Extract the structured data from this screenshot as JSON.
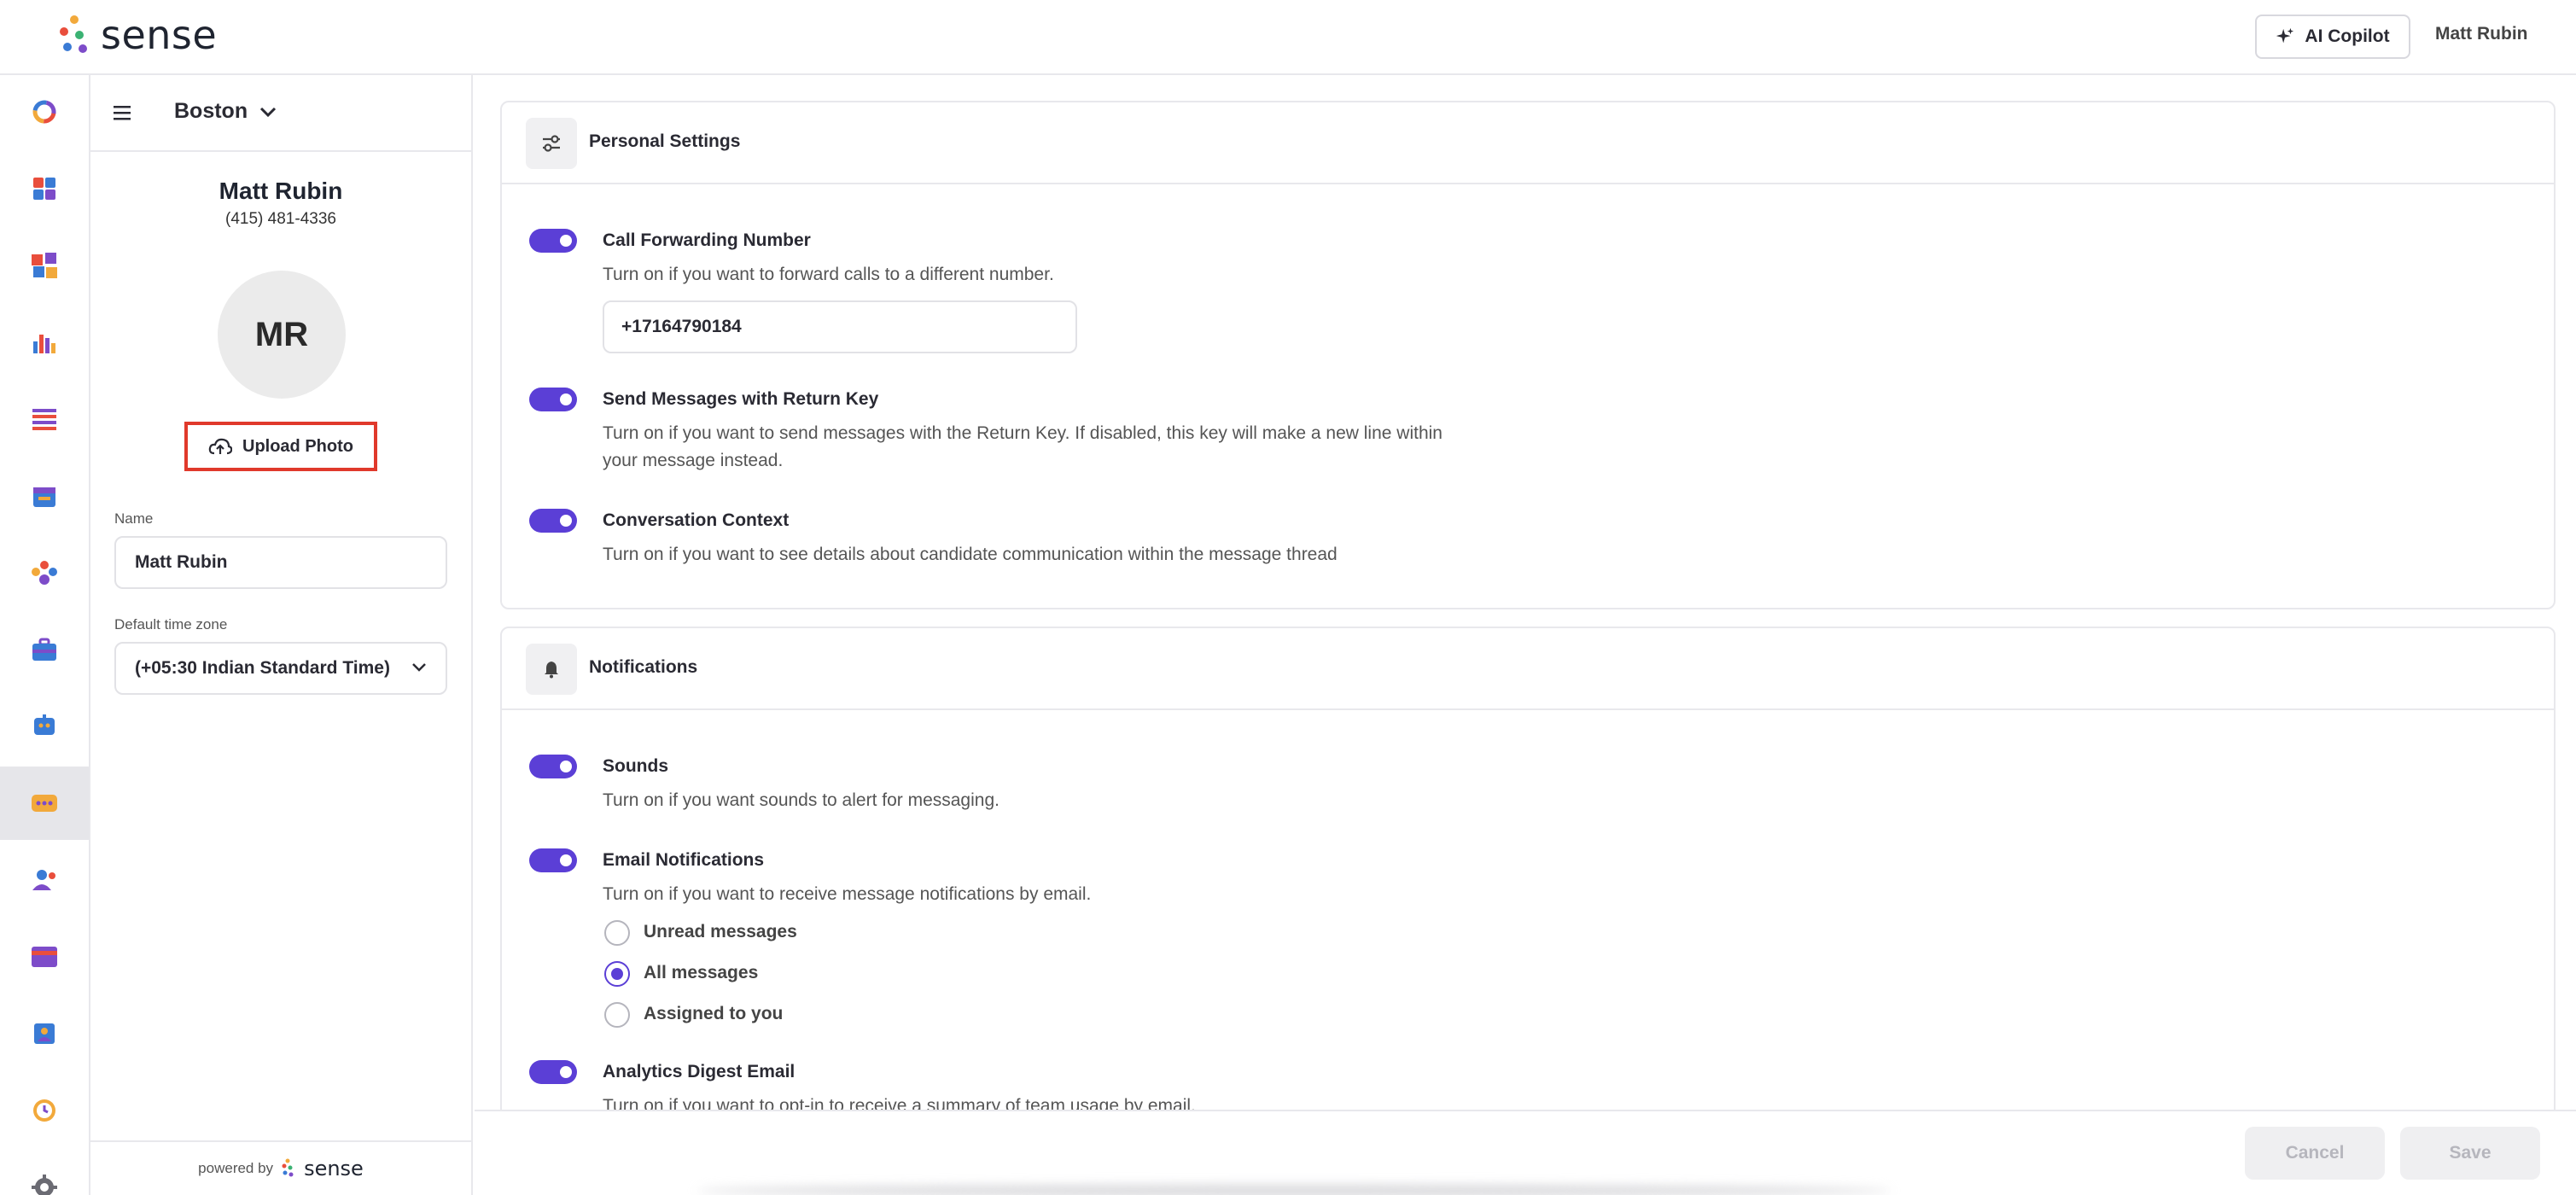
{
  "header": {
    "brand": "sense",
    "copilot_label": "AI Copilot",
    "user_name": "Matt Rubin"
  },
  "rail": {
    "icons": [
      "loading-ring-icon",
      "dashboard-icon",
      "puzzle-icon",
      "analytics-icon",
      "list-icon",
      "calendar-icon",
      "people-icon",
      "briefcase-icon",
      "chatbot-icon",
      "messages-icon",
      "contact-icon",
      "card-icon",
      "profile-card-icon",
      "clock-icon",
      "settings-icon"
    ],
    "active_index": 9
  },
  "profile": {
    "location": "Boston",
    "name": "Matt Rubin",
    "phone": "(415) 481-4336",
    "initials": "MR",
    "upload_label": "Upload Photo",
    "name_label": "Name",
    "name_value": "Matt Rubin",
    "tz_label": "Default time zone",
    "tz_value": "(+05:30 Indian Standard Time)",
    "powered_by": "powered by",
    "powered_brand": "sense"
  },
  "personal": {
    "title": "Personal Settings",
    "forwarding": {
      "title": "Call Forwarding Number",
      "desc": "Turn on if you want to forward calls to a different number.",
      "number": "+17164790184",
      "enabled": true
    },
    "return_key": {
      "title": "Send Messages with Return Key",
      "desc": "Turn on if you want to send messages with the Return Key. If disabled, this key will make a new line within your message instead.",
      "enabled": true
    },
    "context": {
      "title": "Conversation Context",
      "desc": "Turn on if you want to see details about candidate communication within the message thread",
      "enabled": true
    }
  },
  "notifications": {
    "title": "Notifications",
    "sounds": {
      "title": "Sounds",
      "desc": "Turn on if you want sounds to alert for messaging.",
      "enabled": true
    },
    "email": {
      "title": "Email Notifications",
      "desc": "Turn on if you want to receive message notifications by email.",
      "enabled": true,
      "options": [
        "Unread messages",
        "All messages",
        "Assigned to you"
      ],
      "selected": "All messages"
    },
    "digest": {
      "title": "Analytics Digest Email",
      "desc": "Turn on if you want to opt-in to receive a summary of team usage by email.",
      "enabled": true
    }
  },
  "footer": {
    "cancel_label": "Cancel",
    "save_label": "Save"
  },
  "colors": {
    "accent": "#5b3fd6",
    "highlight_border": "#e0392b"
  }
}
